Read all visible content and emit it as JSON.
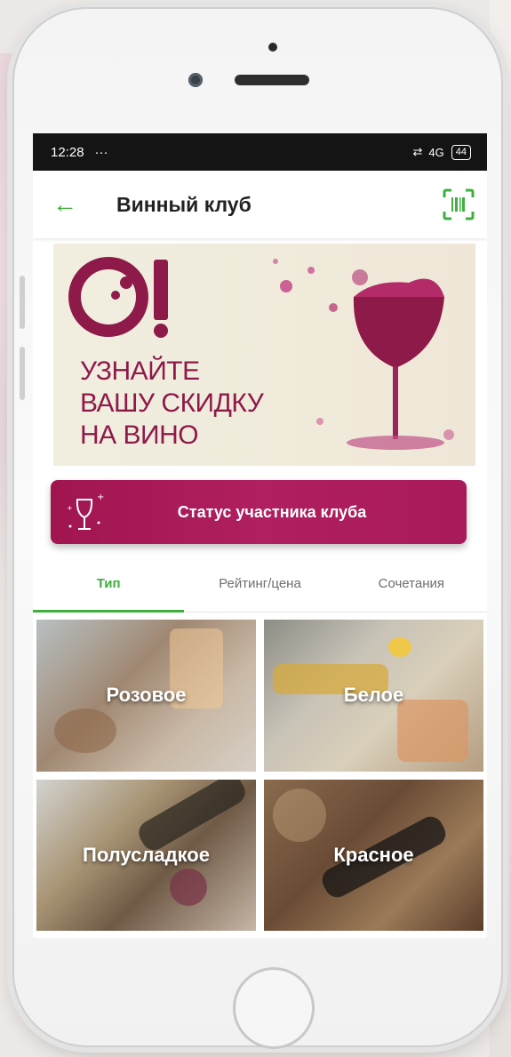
{
  "status_bar": {
    "time": "12:28",
    "dots": "···",
    "network": "4G",
    "battery": "44"
  },
  "app_bar": {
    "title": "Винный клуб",
    "back_icon": "arrow-left-icon",
    "scan_icon": "barcode-scan-icon"
  },
  "banner": {
    "lines": [
      "УЗНАЙТЕ",
      "ВАШУ СКИДКУ",
      "НА ВИНО"
    ]
  },
  "club_status_button": {
    "label": "Статус участника клуба",
    "icon": "wine-glass-icon"
  },
  "tabs": [
    {
      "label": "Тип",
      "active": true
    },
    {
      "label": "Рейтинг/цена",
      "active": false
    },
    {
      "label": "Сочетания",
      "active": false
    }
  ],
  "wine_types": [
    {
      "label": "Розовое"
    },
    {
      "label": "Белое"
    },
    {
      "label": "Полусладкое"
    },
    {
      "label": "Красное"
    }
  ],
  "colors": {
    "accent_green": "#3db03d",
    "brand_wine": "#a01550",
    "status_bar_bg": "#141414"
  }
}
